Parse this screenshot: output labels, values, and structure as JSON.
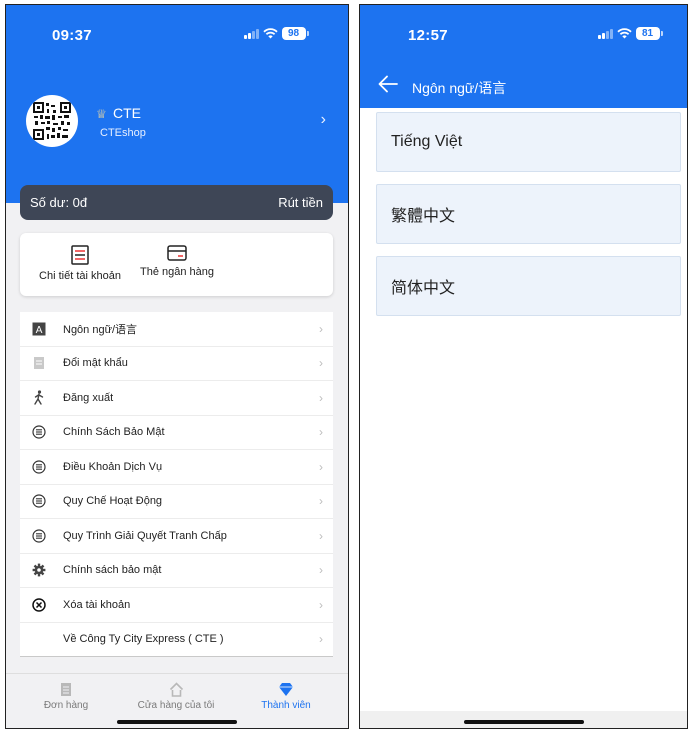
{
  "left_screen": {
    "status": {
      "time": "09:37",
      "battery": "98"
    },
    "profile": {
      "name": "CTE",
      "shop": "CTEshop",
      "chevron": "›"
    },
    "balance": {
      "label": "Số dư: 0đ",
      "withdraw": "Rút tiền"
    },
    "quick_actions": [
      {
        "label": "Chi tiết tài khoản",
        "icon": "account-detail-icon"
      },
      {
        "label": "Thẻ ngân hàng",
        "icon": "bank-card-icon"
      }
    ],
    "menu": [
      {
        "label": "Ngôn ngữ/语言",
        "icon": "language-icon"
      },
      {
        "label": "Đổi mật khẩu",
        "icon": "password-icon"
      },
      {
        "label": "Đăng xuất",
        "icon": "walking-person-icon"
      },
      {
        "label": "Chính Sách Bảo Mật",
        "icon": "list-circle-icon"
      },
      {
        "label": "Điều Khoản Dịch Vụ",
        "icon": "list-circle-icon"
      },
      {
        "label": "Quy Chế Hoạt Động",
        "icon": "list-circle-icon"
      },
      {
        "label": "Quy Trình Giải Quyết Tranh Chấp",
        "icon": "list-circle-icon"
      },
      {
        "label": "Chính sách bảo mật",
        "icon": "gear-icon"
      },
      {
        "label": "Xóa tài khoản",
        "icon": "close-circle-icon"
      },
      {
        "label": "Về Công Ty City Express ( CTE )",
        "icon": ""
      }
    ],
    "tabs": [
      {
        "label": "Đơn hàng",
        "icon": "orders-icon"
      },
      {
        "label": "Cửa hàng của tôi",
        "icon": "home-icon"
      },
      {
        "label": "Thành viên",
        "icon": "diamond-icon"
      }
    ]
  },
  "right_screen": {
    "status": {
      "time": "12:57",
      "battery": "81"
    },
    "title": "Ngôn ngữ/语言",
    "languages": [
      "Tiếng Việt",
      "繁體中文",
      "简体中文"
    ]
  },
  "colors": {
    "brand_blue": "#1d73f0",
    "balance_bg": "#3e4656",
    "lang_item_bg": "#edf3fb"
  }
}
